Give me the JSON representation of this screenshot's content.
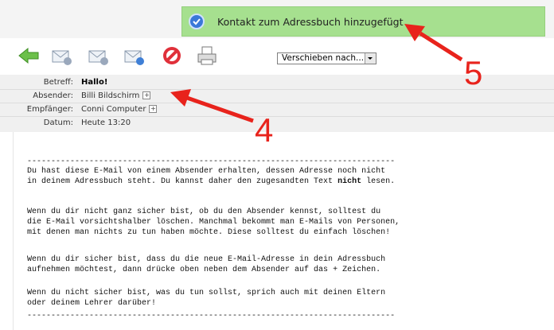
{
  "notification": {
    "text": "Kontakt zum Adressbuch hinzugefügt"
  },
  "toolbar": {
    "icons": [
      "back-arrow-icon",
      "reply-icon",
      "reply-all-icon",
      "forward-icon",
      "block-icon",
      "print-icon"
    ],
    "move_select": "Verschieben nach..."
  },
  "headers": {
    "subject_label": "Betreff:",
    "subject": "Hallo!",
    "sender_label": "Absender:",
    "sender": "Billi Bildschirm",
    "recipient_label": "Empfänger:",
    "recipient": "Conni Computer",
    "date_label": "Datum:",
    "date": "Heute 13:20",
    "plus": "+"
  },
  "body": {
    "divider": "-----------------------------------------------------------------------------",
    "p1_l1": "Du hast diese E-Mail von einem Absender erhalten, dessen Adresse noch nicht",
    "p1_l2a": "in deinem Adressbuch steht. Du kannst daher den zugesandten Text ",
    "p1_l2b": "nicht",
    "p1_l2c": " lesen.",
    "p2_l1": "Wenn du dir nicht ganz sicher bist, ob du den Absender kennst, solltest du",
    "p2_l2": "die E-Mail vorsichtshalber löschen. Manchmal bekommt man E-Mails von Personen,",
    "p2_l3": "mit denen man nichts zu tun haben möchte. Diese solltest du einfach löschen!",
    "p3_l1": "Wenn du dir sicher bist, dass du die neue E-Mail-Adresse in dein Adressbuch",
    "p3_l2": "aufnehmen möchtest, dann drücke oben neben dem Absender auf das + Zeichen.",
    "p4_l1": "Wenn du nicht sicher bist, was du tun sollst, sprich auch mit deinen Eltern",
    "p4_l2": "oder deinem Lehrer darüber!"
  },
  "annotations": {
    "a4": "4",
    "a5": "5"
  },
  "colors": {
    "toast": "#a6e08f",
    "annotation": "#e8231c"
  }
}
